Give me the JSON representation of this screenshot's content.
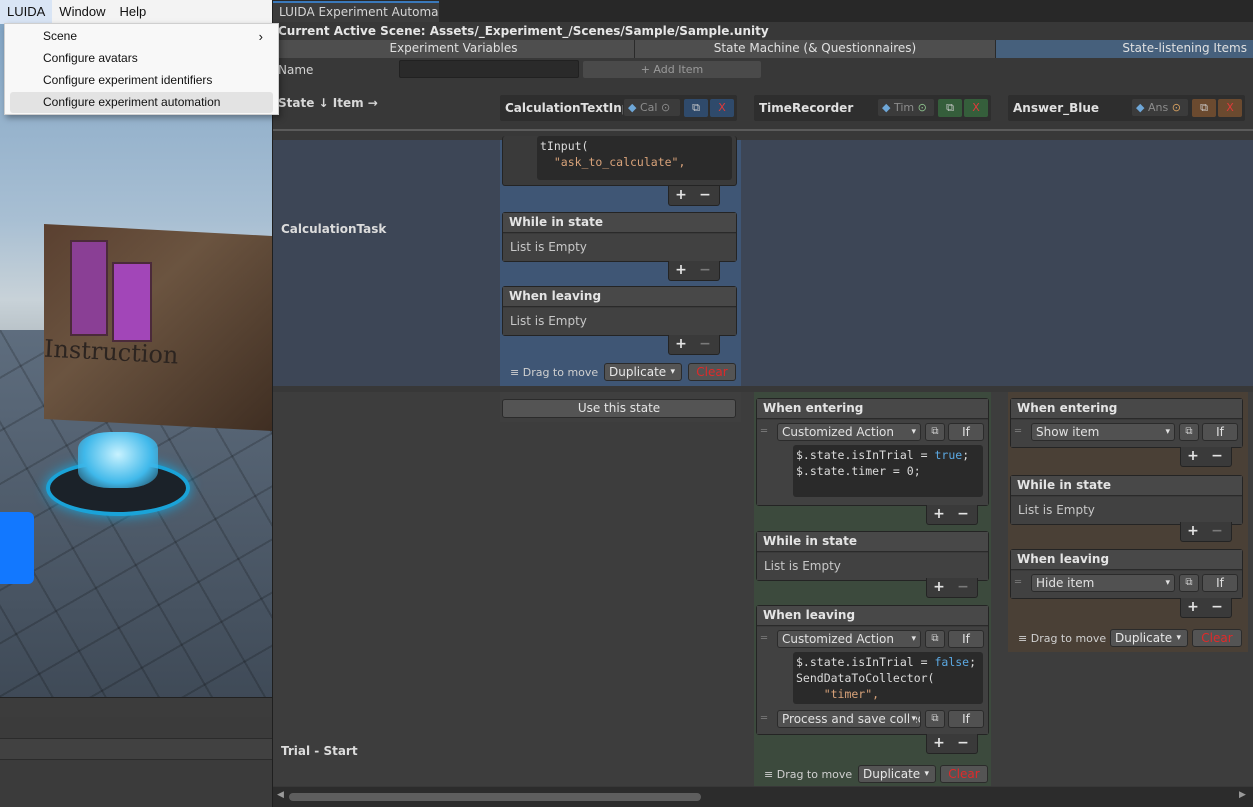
{
  "menubar": {
    "items": [
      "LUIDA",
      "Window",
      "Help"
    ]
  },
  "dropdown": {
    "items": [
      "Scene",
      "Configure avatars",
      "Configure experiment identifiers",
      "Configure experiment automation"
    ],
    "submenu_arrow": "›"
  },
  "scene": {
    "instruction_text": "Instruction"
  },
  "window": {
    "tab_title": "LUIDA Experiment Automa...",
    "scene_path": "Current Active Scene: Assets/_Experiment_/Scenes/Sample/Sample.unity",
    "tabs": [
      "Experiment Variables",
      "State Machine (& Questionnaires)",
      "State-listening Items"
    ],
    "active_tab": "State-listening Items",
    "name_label": "Name",
    "name_value": "",
    "add_item_label": "+ Add Item",
    "header_state": "State ↓  Item →"
  },
  "columns": [
    {
      "title": "CalculationTextInput",
      "object": "Cal",
      "x_label": "X",
      "accent": "#2f4a6b"
    },
    {
      "title": "TimeRecorder",
      "object": "Tim",
      "x_label": "X",
      "accent": "#355e3b"
    },
    {
      "title": "Answer_Blue",
      "object": "Ans",
      "x_label": "X",
      "accent": "#6b4a2f"
    }
  ],
  "rows": [
    {
      "state": "CalculationTask",
      "cells": {
        "calc": {
          "code_lines": [
            "tInput(",
            "  \"ask_to_calculate\","
          ],
          "while_in_state": {
            "title": "While in state",
            "empty": "List is Empty"
          },
          "when_leaving": {
            "title": "When leaving",
            "empty": "List is Empty"
          },
          "drag_label": "Drag to move",
          "duplicate_label": "Duplicate",
          "clear_label": "Clear"
        }
      }
    },
    {
      "state": "Trial - Start",
      "cells": {
        "calc": {
          "use_state_label": "Use this state"
        },
        "timer": {
          "when_entering": {
            "title": "When entering",
            "action": "Customized Action",
            "if_label": "If",
            "code": [
              "$.state.isInTrial = true;",
              "$.state.timer = 0;"
            ]
          },
          "while_in_state": {
            "title": "While in state",
            "empty": "List is Empty"
          },
          "when_leaving": {
            "title": "When leaving",
            "action": "Customized Action",
            "if_label": "If",
            "code": [
              "$.state.isInTrial = false;",
              "SendDataToCollector(",
              "    \"timer\","
            ],
            "action2": "Process and save collected data",
            "if2_label": "If"
          },
          "drag_label": "Drag to move",
          "duplicate_label": "Duplicate",
          "clear_label": "Clear"
        },
        "answer": {
          "when_entering": {
            "title": "When entering",
            "action": "Show item",
            "if_label": "If"
          },
          "while_in_state": {
            "title": "While in state",
            "empty": "List is Empty"
          },
          "when_leaving": {
            "title": "When leaving",
            "action": "Hide item",
            "if_label": "If"
          },
          "drag_label": "Drag to move",
          "duplicate_label": "Duplicate",
          "clear_label": "Clear"
        }
      }
    }
  ],
  "colors": {
    "row_highlight": "#3d4656",
    "calc_cell": "#3f5675",
    "timer_cell": "#3c4a3d",
    "answer_cell": "#4a4036",
    "clear_text": "#e02a2a",
    "active_tab": "#46607c"
  },
  "symbols": {
    "plus": "+",
    "minus": "−",
    "caret": "▾",
    "handle": "═",
    "pick": "⊙",
    "link": "⧉"
  }
}
